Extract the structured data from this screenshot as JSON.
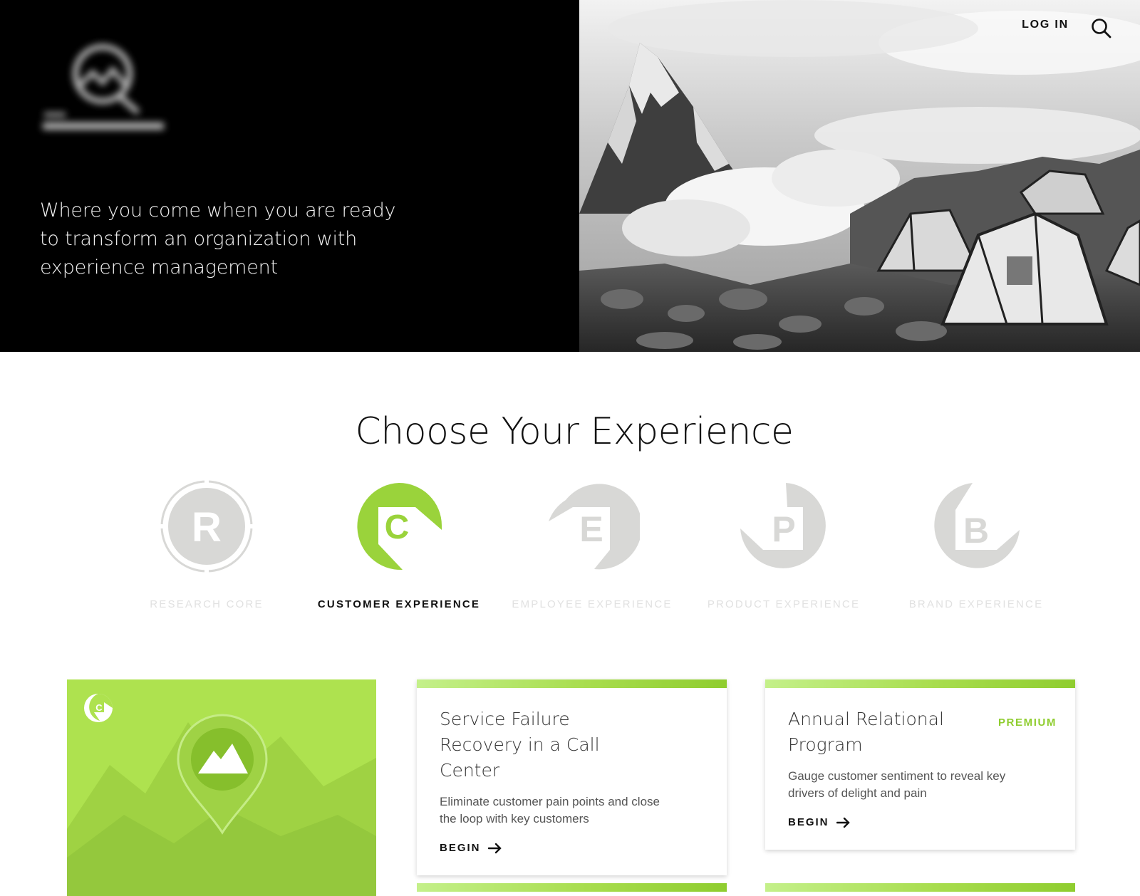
{
  "hero": {
    "tagline": "Where you come when you are ready to transform an organization with experience management",
    "logo_icon": "blurred-brand-logo"
  },
  "nav": {
    "login_label": "LOG IN",
    "search_icon": "search-icon"
  },
  "chooser": {
    "title": "Choose Your Experience",
    "items": [
      {
        "letter": "R",
        "label": "RESEARCH CORE",
        "active": false
      },
      {
        "letter": "C",
        "label": "CUSTOMER EXPERIENCE",
        "active": true
      },
      {
        "letter": "E",
        "label": "EMPLOYEE EXPERIENCE",
        "active": false
      },
      {
        "letter": "P",
        "label": "PRODUCT EXPERIENCE",
        "active": false
      },
      {
        "letter": "B",
        "label": "BRAND EXPERIENCE",
        "active": false
      }
    ]
  },
  "colors": {
    "accent": "#9ad33b",
    "inactive": "#d8d8d6",
    "label_inactive": "#e1e1e1"
  },
  "cards": [
    {
      "title": "Service Failure Recovery in a Call Center",
      "description": "Eliminate customer pain points and close the loop with key customers",
      "action": "BEGIN",
      "badge": ""
    },
    {
      "title": "Annual Relational Program",
      "description": "Gauge customer sentiment to reveal key drivers of delight and pain",
      "action": "BEGIN",
      "badge": "PREMIUM"
    }
  ]
}
